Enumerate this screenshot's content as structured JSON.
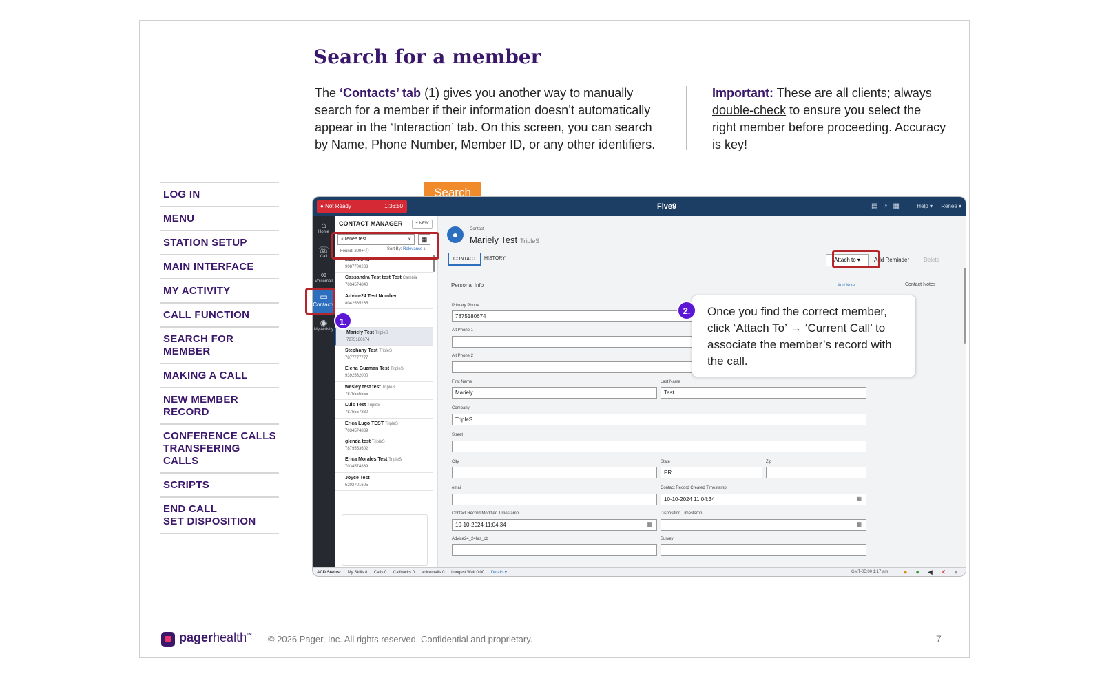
{
  "slide": {
    "title": "Search for a member",
    "intro": {
      "before": "The ",
      "bold": "‘Contacts’ tab",
      "after": " (1) gives you another way to manually search for a member if their information doesn’t automatically appear in the ‘Interaction’ tab. On this screen, you can search by Name, Phone Number, Member ID, or any other identifiers."
    },
    "important": {
      "bold": "Important:",
      "before": " These are all clients; always ",
      "underline": "double-check",
      "after": " to ensure you select the right member before proceeding. Accuracy is key!"
    }
  },
  "nav": [
    {
      "line1": "LOG IN",
      "line2": ""
    },
    {
      "line1": "MENU",
      "line2": ""
    },
    {
      "line1": "STATION SETUP",
      "line2": ""
    },
    {
      "line1": "MAIN INTERFACE",
      "line2": ""
    },
    {
      "line1": "MY ACTIVITY",
      "line2": ""
    },
    {
      "line1": "CALL FUNCTION",
      "line2": ""
    },
    {
      "line1": "SEARCH FOR MEMBER",
      "line2": ""
    },
    {
      "line1": "MAKING A CALL",
      "line2": ""
    },
    {
      "line1": "NEW MEMBER RECORD",
      "line2": ""
    },
    {
      "line1": "CONFERENCE CALLS",
      "line2": "TRANSFERING CALLS"
    },
    {
      "line1": "SCRIPTS",
      "line2": ""
    },
    {
      "line1": "END CALL",
      "line2": "SET DISPOSITION"
    }
  ],
  "annotations": {
    "search_tag": "Search",
    "badge1": "1.",
    "badge2": "2.",
    "callout": "Once you find the correct member, click ‘Attach To’ → ‘Current Call’ to associate the member’s record with the call."
  },
  "app": {
    "status_button": "Not Ready",
    "timer": "1:36:50",
    "brand": "Five9",
    "help": "Help ▾",
    "user": "Renee ▾",
    "left_nav": [
      {
        "label": "Home",
        "icon": "home-icon"
      },
      {
        "label": "Call",
        "icon": "phone-icon"
      },
      {
        "label": "Voicemail",
        "icon": "voicemail-icon"
      },
      {
        "label": "Contacts",
        "icon": "folder-icon"
      },
      {
        "label": "My Activity",
        "icon": "activity-icon"
      }
    ],
    "contact_manager": {
      "title": "CONTACT MANAGER",
      "new_label": "NEW",
      "search_value": "renee test",
      "found": "Found: 200+",
      "sort_by": "Sort By:",
      "sort_value": "Relevance",
      "contacts": [
        {
          "name": "Matt Morin",
          "tag": "",
          "phone": "9087700233"
        },
        {
          "name": "Cassandra Test test Test",
          "tag": "Cambia",
          "phone": "7034574840"
        },
        {
          "name": "Advice24 Test Number",
          "tag": "",
          "phone": "8042565265"
        },
        {
          "name": "",
          "tag": "",
          "phone": ""
        },
        {
          "name": "Mariely Test",
          "tag": "TripleS",
          "phone": "7875180674"
        },
        {
          "name": "Stephany Test",
          "tag": "TripleS",
          "phone": "7877777777"
        },
        {
          "name": "Elena Guzman Test",
          "tag": "TripleS",
          "phone": "9392532000"
        },
        {
          "name": "wesley test test",
          "tag": "TripleS",
          "phone": "7875555555"
        },
        {
          "name": "Luis Test",
          "tag": "TripleS",
          "phone": "7875557830"
        },
        {
          "name": "Erica Lugo TEST",
          "tag": "TripleS",
          "phone": "7034574839"
        },
        {
          "name": "glenda test",
          "tag": "TripleS",
          "phone": "7879553602"
        },
        {
          "name": "Erica Morales Test",
          "tag": "TripleS",
          "phone": "7034574839"
        },
        {
          "name": "Joyce Test",
          "tag": "",
          "phone": "5202701605"
        }
      ]
    },
    "contact": {
      "label": "Contact",
      "name": "Mariely Test",
      "company_tag": "TripleS",
      "tabs": [
        "CONTACT",
        "HISTORY"
      ],
      "attach_to": "Attach to ▾",
      "add_reminder": "Add Reminder",
      "delete": "Delete",
      "section": "Personal Info",
      "add_note": "Add Note",
      "contact_notes": "Contact Notes",
      "fields": {
        "primary_phone": {
          "label": "Primary Phone",
          "value": "7875180674"
        },
        "alt_phone_1": {
          "label": "Alt Phone 1",
          "value": ""
        },
        "alt_phone_2": {
          "label": "Alt Phone 2",
          "value": ""
        },
        "first_name": {
          "label": "First Name",
          "value": "Mariely"
        },
        "last_name": {
          "label": "Last Name",
          "value": "Test"
        },
        "company": {
          "label": "Company",
          "value": "TripleS"
        },
        "street": {
          "label": "Street",
          "value": ""
        },
        "city": {
          "label": "City",
          "value": ""
        },
        "state": {
          "label": "State",
          "value": "PR"
        },
        "zip": {
          "label": "Zip",
          "value": ""
        },
        "email": {
          "label": "email",
          "value": ""
        },
        "created": {
          "label": "Contact Record Created Timestamp",
          "value": "10-10-2024 11:04:34"
        },
        "modified": {
          "label": "Contact Record Modified Timestamp",
          "value": "10-10-2024 11:04:34"
        },
        "disposition": {
          "label": "Disposition Timestamp",
          "value": ""
        },
        "advice": {
          "label": "Advice24_24hrs_cb",
          "value": ""
        },
        "survey": {
          "label": "Survey",
          "value": ""
        }
      }
    },
    "status_bar": {
      "acd": "ACD Status:",
      "skills": "My Skills  8",
      "calls": "Calls  0",
      "callbacks": "Callbacks  0",
      "voicemails": "Voicemails  0",
      "longest_wait": "Longest Wait  0:00",
      "details": "Details ▾",
      "gmt": "GMT-05:00 1:17 am"
    }
  },
  "footer": {
    "brand_bold": "pager",
    "brand_light": "health",
    "tm": "™",
    "copyright": "© 2026 Pager, Inc. All rights reserved. Confidential and proprietary.",
    "page": "7"
  },
  "colors": {
    "brand_purple": "#3b176b",
    "accent_orange": "#f08a2b",
    "highlight_red": "#b6252a",
    "badge_violet": "#5b16d6",
    "app_header": "#1d3e64"
  }
}
